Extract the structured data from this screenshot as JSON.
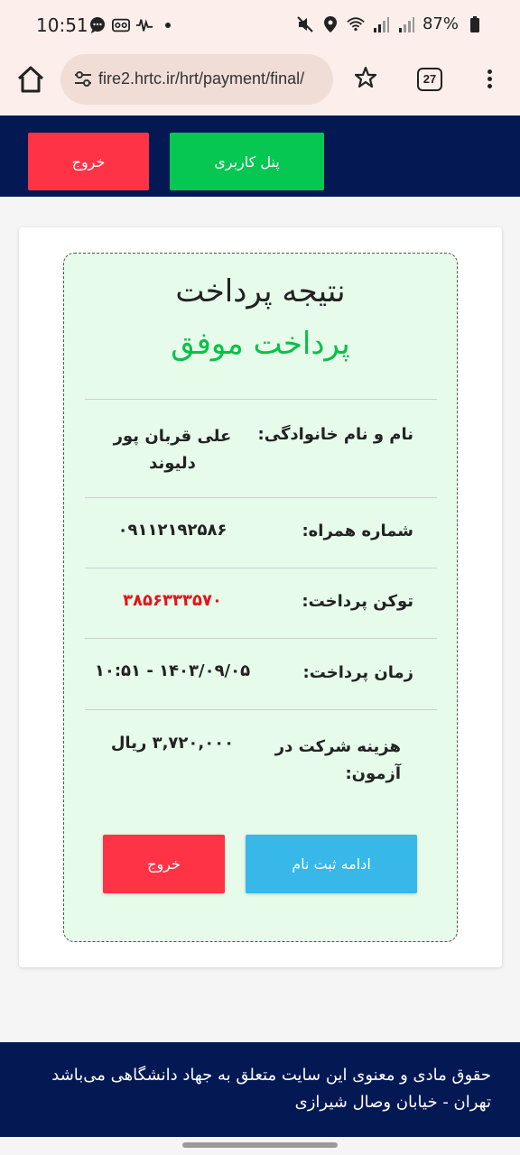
{
  "status_bar": {
    "time": "10:51",
    "battery": "87%",
    "icons": [
      "chat-icon",
      "voicemail-icon",
      "activity-icon",
      "dot-icon",
      "mute-icon",
      "location-icon",
      "wifi-icon",
      "signal-icon",
      "signal-icon",
      "battery-icon"
    ]
  },
  "browser": {
    "url": "fire2.hrtc.ir/hrt/payment/final/",
    "tab_count": "27"
  },
  "header": {
    "exit_label": "خروج",
    "panel_label": "پنل کاربری"
  },
  "result": {
    "title": "نتیجه پرداخت",
    "status": "پرداخت موفق",
    "status_color": "#08c149",
    "rows": [
      {
        "label": "نام و نام خانوادگی:",
        "value_line1": "علی قربان پور",
        "value_line2": "دلیوند"
      },
      {
        "label": "شماره همراه:",
        "value": "۰۹۱۱۲۱۹۲۵۸۶"
      },
      {
        "label": "توکن پرداخت:",
        "value": "۳۸۵۶۳۳۳۵۷۰"
      },
      {
        "label": "زمان پرداخت:",
        "value": "۱۴۰۳/۰۹/۰۵ - ۱۰:۵۱"
      },
      {
        "label_line1": "هزینه شرکت در",
        "label_line2": "آزمون:",
        "value": "۳,۷۲۰,۰۰۰ ریال"
      }
    ],
    "exit_label": "خروج",
    "continue_label": "ادامه ثبت نام"
  },
  "footer": {
    "line1": "حقوق مادی و معنوی این سایت متعلق به جهاد دانشگاهی می‌باشد",
    "line2": "تهران - خیابان وصال شیرازی"
  },
  "colors": {
    "navy": "#041954",
    "red": "#ff3346",
    "green": "#06c751",
    "blue": "#38b7e9",
    "token_red": "#e3141a"
  }
}
